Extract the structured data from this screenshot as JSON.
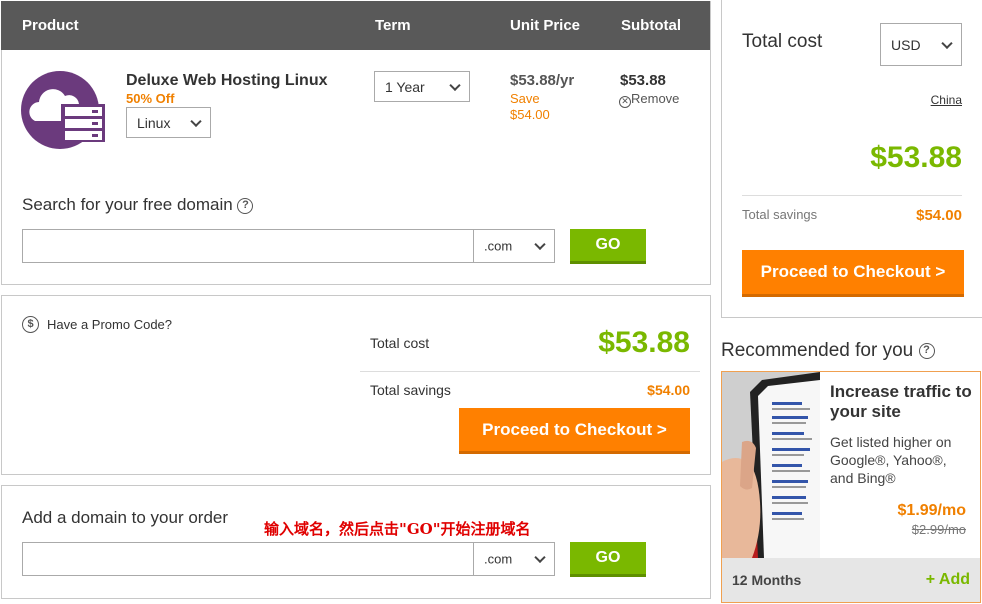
{
  "cart": {
    "headers": {
      "product": "Product",
      "term": "Term",
      "unit_price": "Unit Price",
      "subtotal": "Subtotal"
    },
    "item": {
      "name": "Deluxe Web Hosting Linux",
      "discount": "50% Off",
      "os_select": "Linux",
      "term_select": "1 Year",
      "unit_price": "$53.88/yr",
      "save_label": "Save",
      "save_amount": "$54.00",
      "subtotal": "$53.88",
      "remove_label": "Remove"
    },
    "free_domain": {
      "title": "Search for your free domain",
      "input_value": "",
      "tld_select": ".com",
      "go_label": "GO"
    }
  },
  "promo": {
    "label": "Have a Promo Code?",
    "total_cost_label": "Total cost",
    "total_cost": "$53.88",
    "total_savings_label": "Total savings",
    "total_savings": "$54.00",
    "checkout_label": "Proceed to Checkout >"
  },
  "add_domain": {
    "title": "Add a domain to your order",
    "annotation": "输入域名，然后点击\"GO\"开始注册域名",
    "input_value": "",
    "tld_select": ".com",
    "go_label": "GO"
  },
  "summary": {
    "title": "Total cost",
    "currency_select": "USD",
    "country_link": "China",
    "total": "$53.88",
    "savings_label": "Total savings",
    "savings": "$54.00",
    "checkout_label": "Proceed to Checkout >"
  },
  "recommended": {
    "title": "Recommended for you",
    "card": {
      "headline": "Increase traffic to your site",
      "description": "Get listed higher on Google®, Yahoo®, and Bing®",
      "price": "$1.99/mo",
      "old_price": "$2.99/mo",
      "term": "12 Months",
      "add_label": "+ Add"
    }
  },
  "colors": {
    "accent_green": "#7ab800",
    "accent_orange": "#ff8000",
    "header_gray": "#595959",
    "hosting_icon": "#6b3a7d"
  },
  "icons": [
    "cloud-server-icon",
    "help-icon",
    "remove-icon",
    "dollar-icon",
    "chevron-down-icon"
  ]
}
